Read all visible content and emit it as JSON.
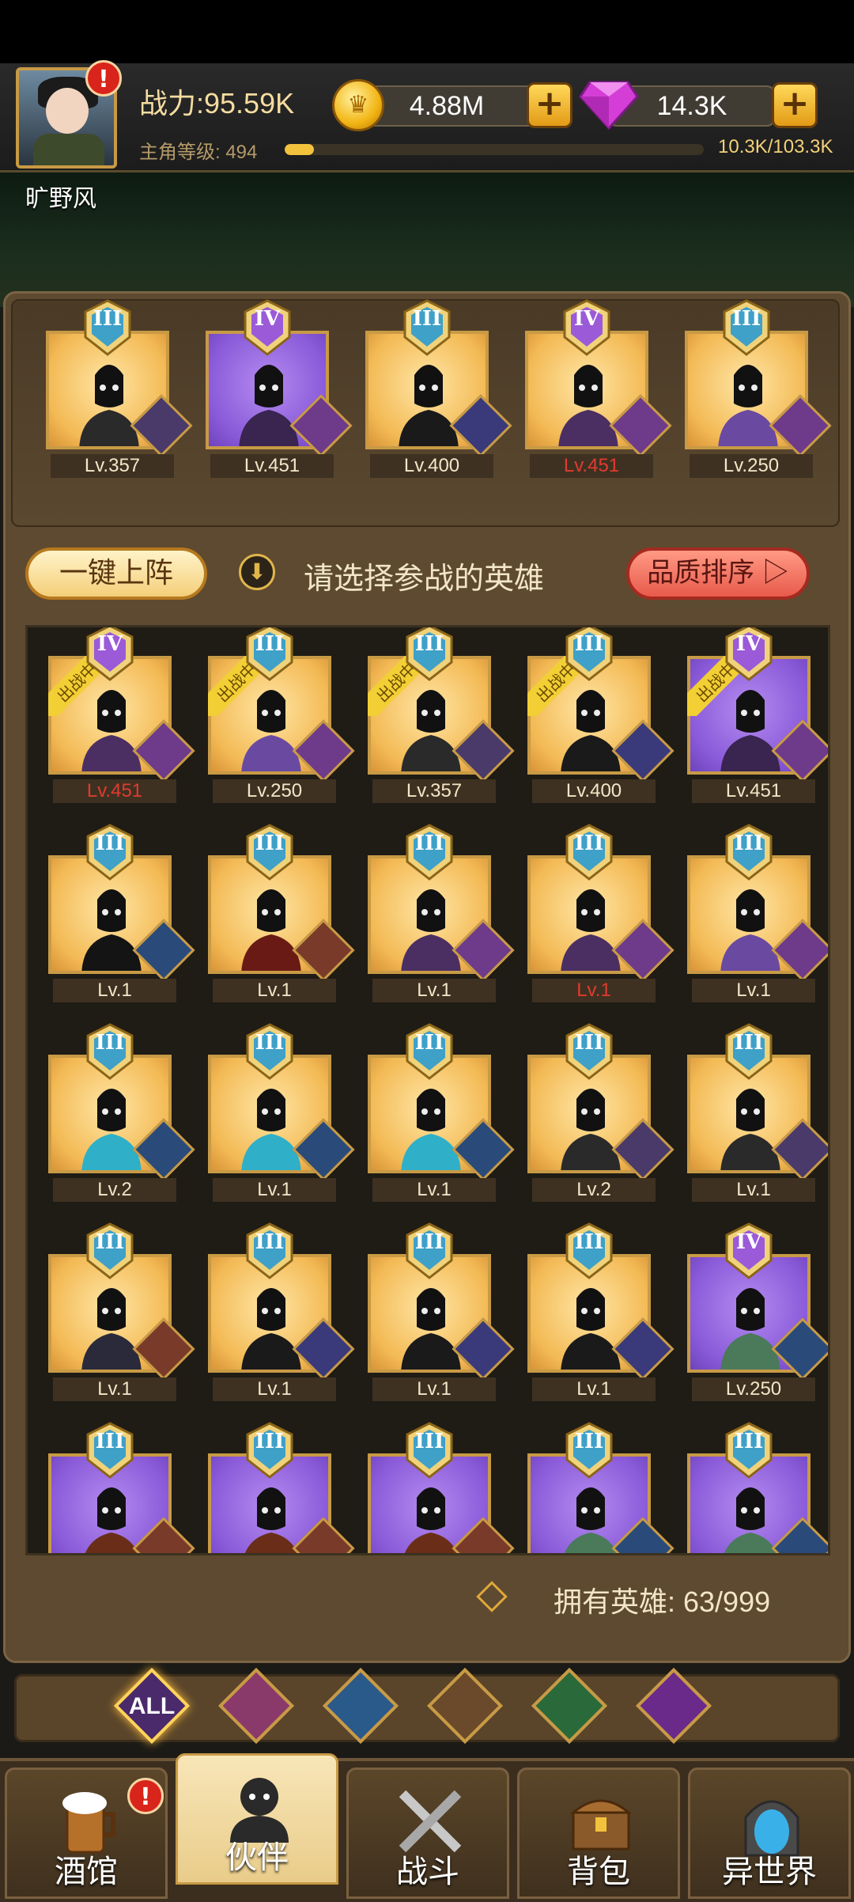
{
  "player": {
    "name": "旷野风",
    "power": "战力:95.59K",
    "level_label": "主角等级: 494",
    "xp_text": "10.3K/103.3K",
    "xp_fraction": 0.07
  },
  "currency": {
    "gold": "4.88M",
    "gems": "14.3K",
    "gold_icon": "crown-coin-icon",
    "gem_icon": "purple-gem-icon"
  },
  "lineup": [
    {
      "rank": "III",
      "level": "Lv.357",
      "portrait": "gold",
      "cls": "elf",
      "hero": "hooded-elf-ranger",
      "red": false
    },
    {
      "rank": "IV",
      "level": "Lv.451",
      "portrait": "purple",
      "cls": "demon",
      "hero": "horned-skull-demon",
      "red": false
    },
    {
      "rank": "III",
      "level": "Lv.400",
      "portrait": "gold",
      "cls": "human",
      "hero": "crowned-king",
      "red": false
    },
    {
      "rank": "IV",
      "level": "Lv.451",
      "portrait": "gold",
      "cls": "demon",
      "hero": "spiked-armor-lord",
      "red": true
    },
    {
      "rank": "III",
      "level": "Lv.250",
      "portrait": "gold",
      "cls": "demon",
      "hero": "purple-horned-brute",
      "red": false
    }
  ],
  "controls": {
    "auto_deploy": "一键上阵",
    "prompt": "请选择参战的英雄",
    "sort": "品质排序",
    "owned": "拥有英雄: 63/999",
    "in_battle_tag": "出战中"
  },
  "heroes": [
    {
      "rank": "IV",
      "level": "Lv.451",
      "portrait": "gold",
      "cls": "demon",
      "hero": "spiked-armor-lord",
      "red": true,
      "tag": true
    },
    {
      "rank": "III",
      "level": "Lv.250",
      "portrait": "gold",
      "cls": "demon",
      "hero": "purple-horned-brute",
      "red": false,
      "tag": true
    },
    {
      "rank": "III",
      "level": "Lv.357",
      "portrait": "gold",
      "cls": "elf",
      "hero": "hooded-elf-ranger",
      "red": false,
      "tag": true
    },
    {
      "rank": "III",
      "level": "Lv.400",
      "portrait": "gold",
      "cls": "human",
      "hero": "crowned-king",
      "red": false,
      "tag": true
    },
    {
      "rank": "IV",
      "level": "Lv.451",
      "portrait": "purple",
      "cls": "demon",
      "hero": "horned-skull-demon",
      "red": false,
      "tag": true
    },
    {
      "rank": "III",
      "level": "Lv.1",
      "portrait": "gold",
      "cls": "murloc",
      "hero": "shadow-assassin",
      "red": false,
      "tag": false
    },
    {
      "rank": "III",
      "level": "Lv.1",
      "portrait": "gold",
      "cls": "beast",
      "hero": "red-hooded-warrior",
      "red": false,
      "tag": false
    },
    {
      "rank": "III",
      "level": "Lv.1",
      "portrait": "gold",
      "cls": "demon",
      "hero": "spiked-armor-lord",
      "red": false,
      "tag": false
    },
    {
      "rank": "III",
      "level": "Lv.1",
      "portrait": "gold",
      "cls": "demon",
      "hero": "spiked-armor-lord",
      "red": true,
      "tag": false
    },
    {
      "rank": "III",
      "level": "Lv.1",
      "portrait": "gold",
      "cls": "demon",
      "hero": "purple-horned-brute",
      "red": false,
      "tag": false
    },
    {
      "rank": "III",
      "level": "Lv.2",
      "portrait": "gold",
      "cls": "murloc",
      "hero": "blue-haired-siren",
      "red": false,
      "tag": false
    },
    {
      "rank": "III",
      "level": "Lv.1",
      "portrait": "gold",
      "cls": "murloc",
      "hero": "blue-haired-siren",
      "red": false,
      "tag": false
    },
    {
      "rank": "III",
      "level": "Lv.1",
      "portrait": "gold",
      "cls": "murloc",
      "hero": "blue-haired-siren",
      "red": false,
      "tag": false
    },
    {
      "rank": "III",
      "level": "Lv.2",
      "portrait": "gold",
      "cls": "elf",
      "hero": "hooded-elf-ranger",
      "red": false,
      "tag": false
    },
    {
      "rank": "III",
      "level": "Lv.1",
      "portrait": "gold",
      "cls": "elf",
      "hero": "hooded-elf-ranger",
      "red": false,
      "tag": false
    },
    {
      "rank": "III",
      "level": "Lv.1",
      "portrait": "gold",
      "cls": "beast",
      "hero": "pharaoh",
      "red": false,
      "tag": false
    },
    {
      "rank": "III",
      "level": "Lv.1",
      "portrait": "gold",
      "cls": "human",
      "hero": "crowned-king",
      "red": false,
      "tag": false
    },
    {
      "rank": "III",
      "level": "Lv.1",
      "portrait": "gold",
      "cls": "human",
      "hero": "crowned-king",
      "red": false,
      "tag": false
    },
    {
      "rank": "III",
      "level": "Lv.1",
      "portrait": "gold",
      "cls": "human",
      "hero": "crowned-king",
      "red": false,
      "tag": false
    },
    {
      "rank": "IV",
      "level": "Lv.250",
      "portrait": "purple",
      "cls": "murloc",
      "hero": "green-sage",
      "red": false,
      "tag": false
    },
    {
      "rank": "III",
      "level": "",
      "portrait": "purple",
      "cls": "beast",
      "hero": "maned-beast",
      "red": false,
      "tag": false
    },
    {
      "rank": "III",
      "level": "",
      "portrait": "purple",
      "cls": "beast",
      "hero": "maned-beast",
      "red": false,
      "tag": false
    },
    {
      "rank": "III",
      "level": "",
      "portrait": "purple",
      "cls": "beast",
      "hero": "maned-beast",
      "red": false,
      "tag": false
    },
    {
      "rank": "III",
      "level": "",
      "portrait": "purple",
      "cls": "murloc",
      "hero": "green-sage",
      "red": false,
      "tag": false
    },
    {
      "rank": "III",
      "level": "",
      "portrait": "purple",
      "cls": "murloc",
      "hero": "green-sage",
      "red": false,
      "tag": false
    }
  ],
  "filters": [
    {
      "label": "ALL",
      "icon": "all-filter-icon",
      "active": true
    },
    {
      "label": "",
      "icon": "human-crown-filter-icon",
      "active": false
    },
    {
      "label": "",
      "icon": "murloc-filter-icon",
      "active": false
    },
    {
      "label": "",
      "icon": "lion-beast-filter-icon",
      "active": false
    },
    {
      "label": "",
      "icon": "elf-filter-icon",
      "active": false
    },
    {
      "label": "",
      "icon": "demon-filter-icon",
      "active": false
    }
  ],
  "nav": [
    {
      "label": "酒馆",
      "icon": "beer-mug-icon",
      "active": false,
      "alert": true
    },
    {
      "label": "伙伴",
      "icon": "partner-silhouette-icon",
      "active": true,
      "alert": false
    },
    {
      "label": "战斗",
      "icon": "crossed-swords-icon",
      "active": false,
      "alert": false
    },
    {
      "label": "背包",
      "icon": "treasure-chest-icon",
      "active": false,
      "alert": false
    },
    {
      "label": "异世界",
      "icon": "portal-icon",
      "active": false,
      "alert": false
    }
  ],
  "colors": {
    "gold_frame": "#c89a45",
    "purple_card": "#8a5ad9",
    "gold_card": "#f3ba55",
    "level_red": "#e23a30",
    "in_battle_tag": "#f2cf34"
  }
}
